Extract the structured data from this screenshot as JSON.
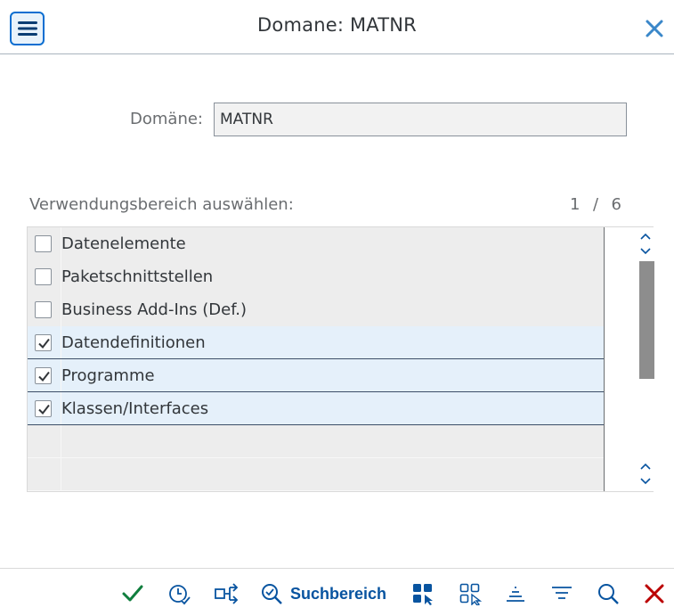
{
  "header": {
    "title": "Domane: MATNR",
    "menu_icon": "hamburger-menu-icon",
    "close_icon": "close-icon"
  },
  "form": {
    "domain_label": "Domäne:",
    "domain_value": "MATNR"
  },
  "usage": {
    "label": "Verwendungsbereich auswählen:",
    "page_current": "1",
    "page_sep": "/",
    "page_total": "6",
    "items": [
      {
        "label": "Datenelemente",
        "checked": false
      },
      {
        "label": "Paketschnittstellen",
        "checked": false
      },
      {
        "label": "Business Add-Ins (Def.)",
        "checked": false
      },
      {
        "label": "Datendefinitionen",
        "checked": true
      },
      {
        "label": "Programme",
        "checked": true
      },
      {
        "label": "Klassen/Interfaces",
        "checked": true
      }
    ]
  },
  "toolbar": {
    "ok_icon": "checkmark-icon",
    "history_icon": "clock-history-icon",
    "shuffle_icon": "shuffle-icon",
    "search_area_label": "Suchbereich",
    "select_all_icon": "select-all-icon",
    "deselect_all_icon": "deselect-all-icon",
    "collapse_icon": "align-center-icon",
    "filter_icon": "filter-icon",
    "find_icon": "search-icon",
    "cancel_icon": "cancel-icon"
  },
  "colors": {
    "accent": "#0a6ed1",
    "ok": "#107e3e",
    "cancel": "#bb0000"
  }
}
